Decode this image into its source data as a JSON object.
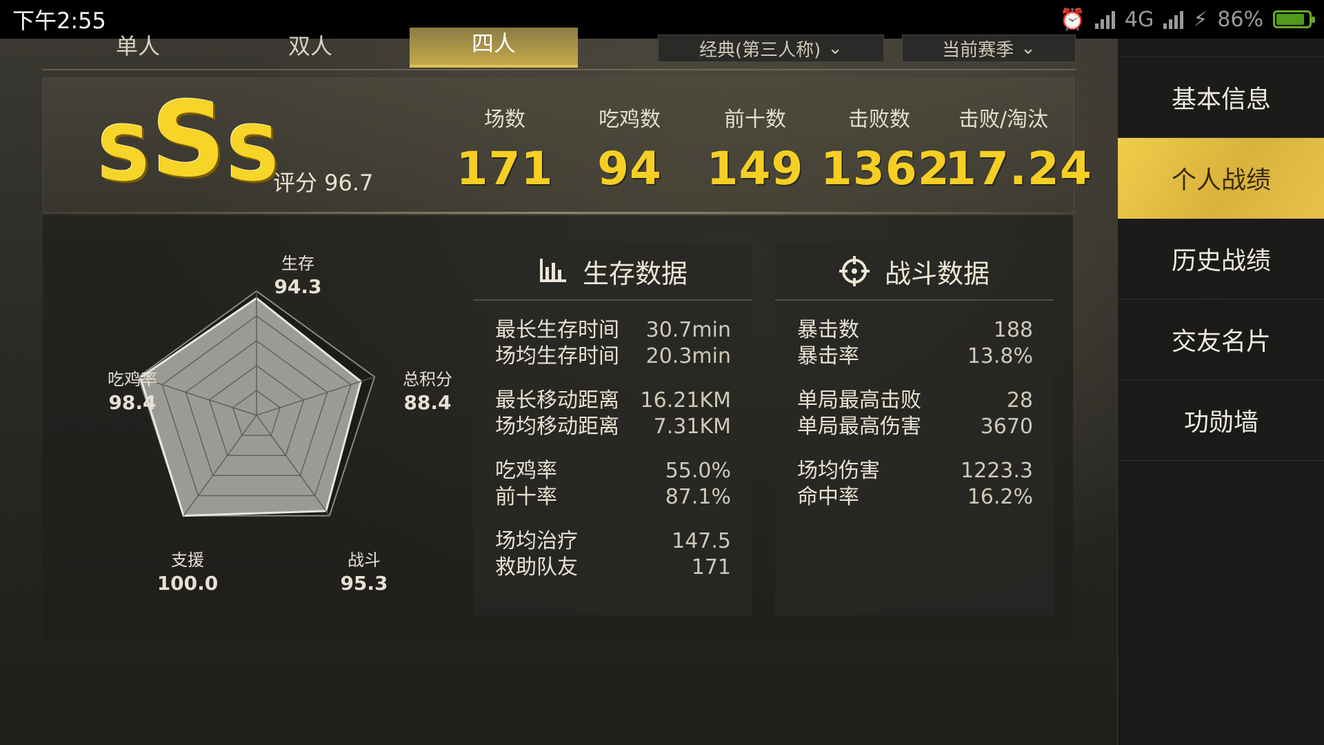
{
  "status_bar": {
    "time": "下午2:55",
    "network": "4G",
    "battery": "86%"
  },
  "top_tabs": [
    {
      "label": "单人",
      "active": false
    },
    {
      "label": "双人",
      "active": false
    },
    {
      "label": "四人",
      "active": true
    }
  ],
  "dropdowns": [
    "经典(第三人称)",
    "当前赛季"
  ],
  "summary": {
    "grade": [
      "S",
      "S",
      "S"
    ],
    "score_label": "评分 96.7",
    "stats": [
      {
        "label": "场数",
        "value": "171"
      },
      {
        "label": "吃鸡数",
        "value": "94"
      },
      {
        "label": "前十数",
        "value": "149"
      },
      {
        "label": "击败数",
        "value": "1362"
      },
      {
        "label": "击败/淘汰",
        "value": "17.24"
      }
    ]
  },
  "radar": {
    "axes": [
      {
        "label": "生存",
        "value": "94.3",
        "score": 94.3
      },
      {
        "label": "总积分",
        "value": "88.4",
        "score": 88.4
      },
      {
        "label": "战斗",
        "value": "95.3",
        "score": 95.3
      },
      {
        "label": "支援",
        "value": "100.0",
        "score": 100.0
      },
      {
        "label": "吃鸡率",
        "value": "98.4",
        "score": 98.4
      }
    ],
    "max": 100
  },
  "survival": {
    "title": "生存数据",
    "groups": [
      [
        {
          "k": "最长生存时间",
          "v": "30.7min"
        },
        {
          "k": "场均生存时间",
          "v": "20.3min"
        }
      ],
      [
        {
          "k": "最长移动距离",
          "v": "16.21KM"
        },
        {
          "k": "场均移动距离",
          "v": "7.31KM"
        }
      ],
      [
        {
          "k": "吃鸡率",
          "v": "55.0%"
        },
        {
          "k": "前十率",
          "v": "87.1%"
        }
      ],
      [
        {
          "k": "场均治疗",
          "v": "147.5"
        },
        {
          "k": "救助队友",
          "v": "171"
        }
      ]
    ]
  },
  "combat": {
    "title": "战斗数据",
    "groups": [
      [
        {
          "k": "暴击数",
          "v": "188"
        },
        {
          "k": "暴击率",
          "v": "13.8%"
        }
      ],
      [
        {
          "k": "单局最高击败",
          "v": "28"
        },
        {
          "k": "单局最高伤害",
          "v": "3670"
        }
      ],
      [
        {
          "k": "场均伤害",
          "v": "1223.3"
        },
        {
          "k": "命中率",
          "v": "16.2%"
        }
      ]
    ]
  },
  "side_menu": [
    {
      "label": "基本信息",
      "active": false
    },
    {
      "label": "个人战绩",
      "active": true
    },
    {
      "label": "历史战绩",
      "active": false
    },
    {
      "label": "交友名片",
      "active": false
    },
    {
      "label": "功勋墙",
      "active": false
    }
  ],
  "colors": {
    "accent": "#f6cf24",
    "active_tab": "#e0c25a",
    "panel": "#2a2a27"
  }
}
